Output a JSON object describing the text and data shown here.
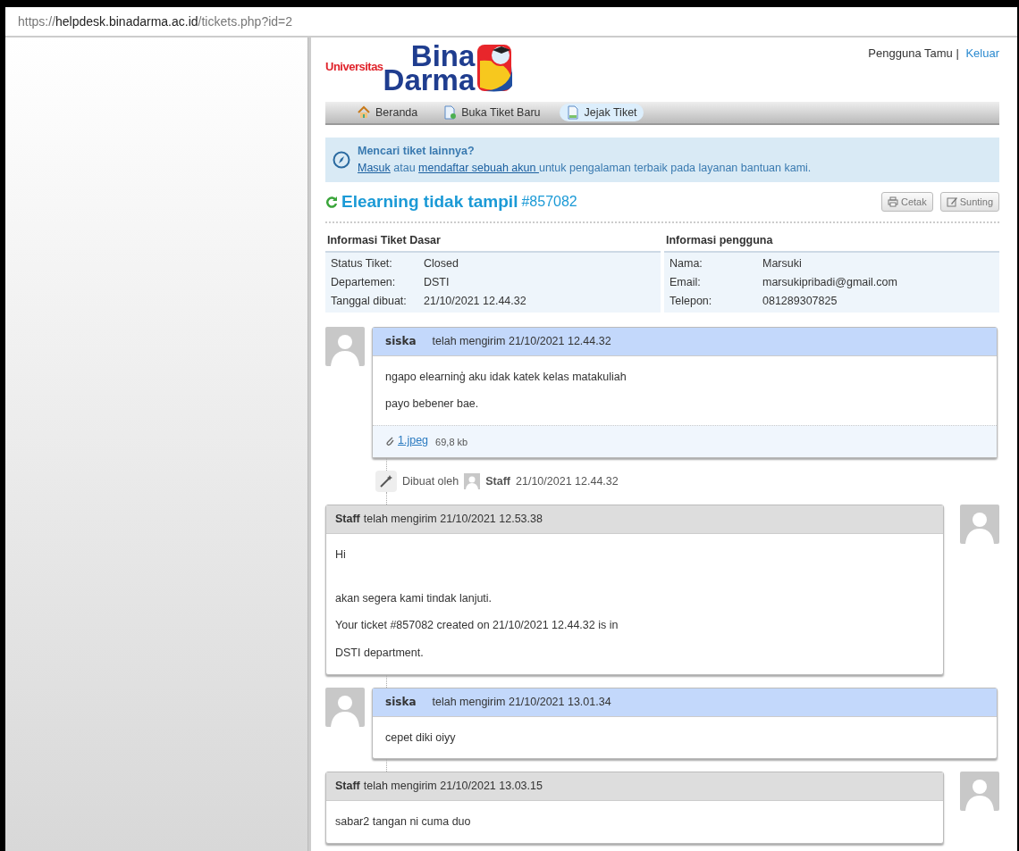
{
  "address_bar": {
    "scheme": "https://",
    "host": "helpdesk.binadarma.ac.id",
    "path": "/tickets.php?id=2"
  },
  "logo": {
    "prefix": "Universitas",
    "line1": "Bina",
    "line2": "Darma"
  },
  "user_bar": {
    "user": "Pengguna Tamu",
    "separator": "|",
    "logout": "Keluar"
  },
  "nav": [
    {
      "label": "Beranda",
      "kind": "home",
      "selected": false
    },
    {
      "label": "Buka Tiket Baru",
      "kind": "new",
      "selected": false
    },
    {
      "label": "Jejak Tiket",
      "kind": "doc",
      "selected": true
    }
  ],
  "notice": {
    "title": "Mencari tiket lainnya?",
    "parts": [
      {
        "kind": "link",
        "text": "Masuk"
      },
      {
        "kind": "text",
        "text": " atau "
      },
      {
        "kind": "link",
        "text": "mendaftar sebuah akun "
      },
      {
        "kind": "text",
        "text": "untuk pengalaman terbaik pada layanan bantuan kami."
      }
    ]
  },
  "ticket": {
    "title": "Elearning tidak tampil",
    "number": "#857082",
    "buttons": [
      {
        "label": "Cetak",
        "kind": "print"
      },
      {
        "label": "Sunting",
        "kind": "edit"
      }
    ]
  },
  "info_sections": [
    {
      "heading": "Informasi Tiket Dasar",
      "rows": [
        {
          "label": "Status Tiket:",
          "value": "Closed"
        },
        {
          "label": "Departemen:",
          "value": "DSTI"
        },
        {
          "label": "Tanggal dibuat:",
          "value": "21/10/2021 12.44.32"
        }
      ]
    },
    {
      "heading": "Informasi pengguna",
      "rows": [
        {
          "label": "Nama:",
          "value": "Marsuki"
        },
        {
          "label": "Email:",
          "value": "marsukipribadi@gmail.com"
        },
        {
          "label": "Telepon:",
          "value": "081289307825"
        }
      ]
    }
  ],
  "thread": [
    {
      "kind": "user",
      "author": "siska",
      "meta": "telah mengirim 21/10/2021 12.44.32",
      "paragraph_groups": [
        [
          "ngapo elearninģ aku idak katek kelas matakuliah",
          "payo bebener bae."
        ]
      ],
      "attachments": [
        {
          "name": "1.jpeg",
          "size": "69,8 kb"
        }
      ]
    },
    {
      "kind": "event",
      "text": "Dibuat oleh",
      "author": "Staff",
      "time": "21/10/2021 12.44.32"
    },
    {
      "kind": "staff",
      "author": "Staff",
      "meta": "telah mengirim 21/10/2021 12.53.38",
      "paragraph_groups": [
        [
          "Hi"
        ],
        [
          "akan segera kami tindak lanjuti.",
          "Your ticket #857082 created on 21/10/2021 12.44.32 is in",
          "DSTI department."
        ]
      ]
    },
    {
      "kind": "user",
      "author": "siska",
      "meta": "telah mengirim 21/10/2021 13.01.34",
      "paragraph_groups": [
        [
          "cepet diki oiyy"
        ]
      ]
    },
    {
      "kind": "staff",
      "author": "Staff",
      "meta": "telah mengirim 21/10/2021 13.03.15",
      "paragraph_groups": [
        [
          "sabar2 tangan ni cuma duo"
        ]
      ]
    }
  ]
}
